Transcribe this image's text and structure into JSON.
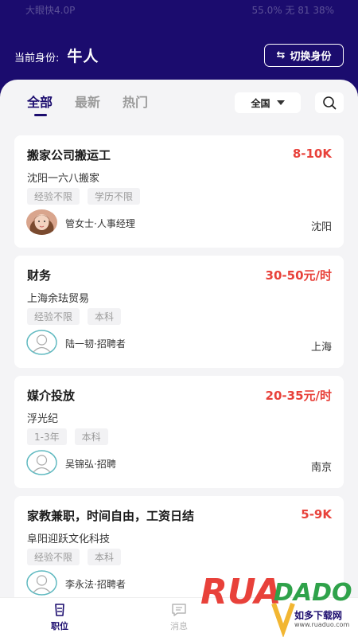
{
  "status_bar": {
    "left": "大眼快4.0P",
    "right": "55.0% 无 81 38%"
  },
  "header": {
    "identity_label": "当前身份:",
    "identity_value": "牛人",
    "switch_button_label": "切换身份"
  },
  "tabs": [
    {
      "label": "全部",
      "active": true
    },
    {
      "label": "最新",
      "active": false
    },
    {
      "label": "热门",
      "active": false
    }
  ],
  "region_select": {
    "value": "全国"
  },
  "jobs": [
    {
      "title": "搬家公司搬运工",
      "salary": "8-10K",
      "company": "沈阳一六八搬家",
      "tags": [
        "经验不限",
        "学历不限"
      ],
      "recruiter": "管女士·人事经理",
      "city": "沈阳",
      "avatar": "photo"
    },
    {
      "title": "财务",
      "salary": "30-50元/时",
      "company": "上海余珐贸易",
      "tags": [
        "经验不限",
        "本科"
      ],
      "recruiter": "陆一韧·招聘者",
      "city": "上海",
      "avatar": "default"
    },
    {
      "title": "媒介投放",
      "salary": "20-35元/时",
      "company": "浮光纪",
      "tags": [
        "1-3年",
        "本科"
      ],
      "recruiter": "吴锦弘·招聘",
      "city": "南京",
      "avatar": "default"
    },
    {
      "title": "家教兼职，时间自由，工资日结",
      "salary": "5-9K",
      "company": "阜阳迎跃文化科技",
      "tags": [
        "经验不限",
        "本科"
      ],
      "recruiter": "李永法·招聘者",
      "city": "",
      "avatar": "default"
    }
  ],
  "bottom_nav": [
    {
      "label": "职位",
      "icon": "briefcase-icon",
      "active": true
    },
    {
      "label": "消息",
      "icon": "message-icon",
      "active": false
    }
  ],
  "watermark": {
    "logo_text": "RUANDADO",
    "subtitle": "如多下载网",
    "url": "www.ruaduo.com"
  },
  "colors": {
    "primary": "#1b0c6e",
    "salary": "#e8413a",
    "background": "#f4f4f6"
  }
}
